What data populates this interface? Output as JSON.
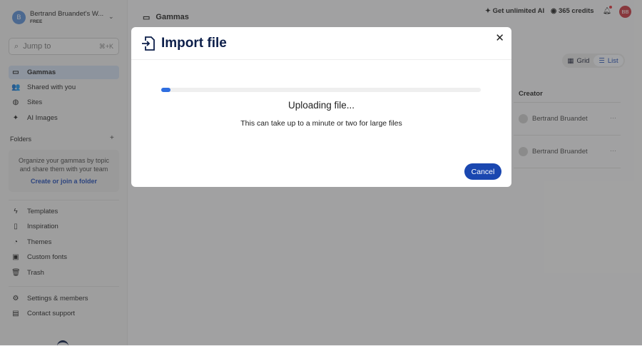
{
  "workspace": {
    "initial": "B",
    "name": "Bertrand Bruandet's W...",
    "plan": "FREE"
  },
  "search": {
    "placeholder": "Jump to",
    "shortcut": "⌘+K"
  },
  "nav": [
    {
      "label": "Gammas",
      "icon": "folder-icon"
    },
    {
      "label": "Shared with you",
      "icon": "users-icon"
    },
    {
      "label": "Sites",
      "icon": "globe-icon"
    },
    {
      "label": "AI Images",
      "icon": "sparkle-icon"
    }
  ],
  "folders": {
    "title": "Folders",
    "empty_text": "Organize your gammas by topic and share them with your team",
    "link": "Create or join a folder"
  },
  "nav2": [
    {
      "label": "Templates"
    },
    {
      "label": "Inspiration"
    },
    {
      "label": "Themes"
    },
    {
      "label": "Custom fonts"
    },
    {
      "label": "Trash"
    }
  ],
  "nav3": [
    {
      "label": "Settings & members"
    },
    {
      "label": "Contact support"
    }
  ],
  "header": {
    "title": "Gammas",
    "unlimited": "Get unlimited AI",
    "credits": "365 credits",
    "avatar": "BB"
  },
  "view": {
    "grid": "Grid",
    "list": "List"
  },
  "table": {
    "creator_header": "Creator",
    "rows": [
      {
        "creator": "Bertrand Bruandet"
      },
      {
        "creator": "Bertrand Bruandet"
      }
    ]
  },
  "modal": {
    "title": "Import file",
    "progress": 0.03,
    "status": "Uploading file...",
    "note": "This can take up to a minute or two for large files",
    "cancel": "Cancel"
  }
}
